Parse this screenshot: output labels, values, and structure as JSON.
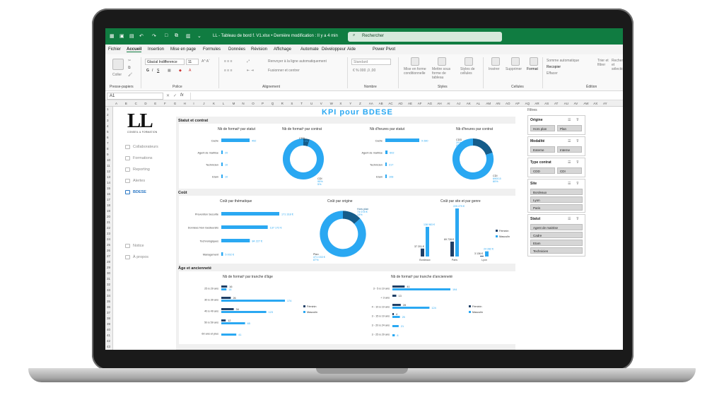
{
  "excel": {
    "file_title": "LL - Tableau de bord f. V1.xlsx • Dernière modification : Il y a 4 min",
    "search_placeholder": "Rechercher",
    "menu": [
      "Fichier",
      "Accueil",
      "Insertion",
      "Mise en page",
      "Formules",
      "Données",
      "Révision",
      "Affichage",
      "Automate",
      "Développeur",
      "Aide",
      "Power Pivot"
    ],
    "ribbon": {
      "paste": "Coller",
      "clipboard": "Presse-papiers",
      "font_name": "Glacial Indifference",
      "font_size": "11",
      "police": "Police",
      "wrap": "Renvoyer à la ligne automatiquement",
      "merge": "Fusionner et centrer",
      "alignment": "Alignement",
      "number_format": "Standard",
      "nombre": "Nombre",
      "cond_format": "Mise en forme conditionnelle",
      "table_format": "Mettre sous forme de tableau",
      "cell_styles": "Styles de cellules",
      "styles": "Styles",
      "insert": "Insérer",
      "delete": "Supprimer",
      "format": "Format",
      "cells": "Cellules",
      "autosum": "Somme automatique",
      "fill": "Recopier",
      "clear": "Effacer",
      "sort": "Trier et filtrer",
      "find": "Rechercher et sélectionner",
      "edition": "Édition"
    },
    "name_box": "A1",
    "formula_fx": "fx",
    "columns": [
      "A",
      "B",
      "C",
      "D",
      "E",
      "F",
      "G",
      "H",
      "I",
      "J",
      "K",
      "L",
      "M",
      "N",
      "O",
      "P",
      "Q",
      "R",
      "S",
      "T",
      "U",
      "V",
      "W",
      "X",
      "Y",
      "Z",
      "AA",
      "AB",
      "AC",
      "AD",
      "AE",
      "AF",
      "AG",
      "AH",
      "AI",
      "AJ",
      "AK",
      "AL",
      "AM",
      "AN",
      "AO",
      "AP",
      "AQ",
      "AR",
      "AS",
      "AT",
      "AU",
      "AV",
      "AW",
      "AX",
      "AY"
    ],
    "rows": [
      "1",
      "2",
      "3",
      "4",
      "5",
      "6",
      "7",
      "8",
      "9",
      "10",
      "11",
      "12",
      "13",
      "14",
      "15",
      "16",
      "17",
      "18",
      "19",
      "20",
      "21",
      "22",
      "23",
      "24",
      "25",
      "26",
      "27",
      "28",
      "29",
      "30",
      "31",
      "32",
      "33",
      "34",
      "35",
      "36",
      "37",
      "38",
      "39",
      "40",
      "41",
      "42",
      "43"
    ]
  },
  "logo": {
    "mark": "LL",
    "sub": "CONSEIL & FORMATION"
  },
  "nav": {
    "items": [
      "Collaborateurs",
      "Formations",
      "Reporting",
      "Alertes",
      "BDESE"
    ],
    "footer": [
      "Notice",
      "À propos"
    ]
  },
  "dashboard": {
    "title": "KPI pour BDESE",
    "sections": {
      "statut": "Statut et contrat",
      "cout": "Coût",
      "age": "Âge et ancienneté"
    }
  },
  "charts": {
    "formations_statut": {
      "title": "Nb de formatº par statut",
      "categories": [
        "Cadre",
        "Agent de maitrise",
        "Technicien",
        "Etam"
      ],
      "values": [
        "492",
        "20",
        "10",
        "10"
      ]
    },
    "formations_contrat": {
      "title": "Nb de formatº par contrat",
      "labels": [
        "CDD",
        "CDI"
      ],
      "pct": [
        "5%",
        "95%"
      ],
      "detail": "CDI 3%"
    },
    "heures_statut": {
      "title": "Nb d'heures par statut",
      "categories": [
        "Cadre",
        "Agent de maitrise",
        "Technicien",
        "Etam"
      ],
      "values": [
        "9 280",
        "602",
        "217",
        "108"
      ]
    },
    "heures_contrat": {
      "title": "Nb d'heures par contrat",
      "labels": [
        "CDD",
        "CDI"
      ],
      "pct": [
        "20%",
        "80%"
      ],
      "values": [
        "(5%)",
        "6900,5"
      ]
    },
    "cout_thematique": {
      "title": "Coût par thématique",
      "categories": [
        "Prevention Securite",
        "Données Non Gesteursils",
        "Technologiques",
        "Management"
      ],
      "values": [
        "171 318 €",
        "137 172 €",
        "84 227 €",
        "5 002 €"
      ]
    },
    "cout_origine": {
      "title": "Coût par origine",
      "labels": [
        "Hors plan",
        "Plan"
      ],
      "values": [
        "73 078 €",
        "471 033 €"
      ],
      "pct": [
        "13%",
        "87%"
      ]
    },
    "cout_site": {
      "title": "Coût par site et par genre",
      "categories": [
        "Bordeaux",
        "Paris",
        "Lyon"
      ],
      "feminin": [
        "37 201 €",
        "69 728 €",
        "3 136 €"
      ],
      "masculin": [
        "138 983 €",
        "225 279 €",
        "24 282 €"
      ],
      "legend": [
        "Féminin",
        "Masculin"
      ]
    },
    "age": {
      "title": "Nb de formatº par tranche d'âge",
      "categories": [
        "25 à 29 ans",
        "30 à 39 ans",
        "40 à 49 ans",
        "50 à 59 ans",
        "60 ans et plus"
      ],
      "feminin": [
        "16",
        "26",
        "34",
        "12",
        ""
      ],
      "masculin": [
        "14",
        "174",
        "123",
        "65",
        "41"
      ],
      "legend": [
        "Féminin",
        "Masculin"
      ]
    },
    "anciennete": {
      "title": "Nb de formatº par tranche d'ancienneté",
      "categories": [
        "3 - 5 à 19 ans",
        "< 3 ans",
        "4 - 10 à 19 ans",
        "3 - 15 à 19 ans",
        "3 - 20 à 24 ans",
        "3 - 25 à 29 ans"
      ],
      "feminin": [
        "41",
        "13",
        "28",
        "4",
        "",
        ""
      ],
      "masculin": [
        "194",
        "",
        "124",
        "25",
        "21",
        "8"
      ],
      "legend": [
        "Féminin",
        "Masculin"
      ]
    }
  },
  "filters": {
    "header": "Filtres",
    "groups": [
      {
        "title": "Origine",
        "chips": [
          "Hors plan",
          "Plan"
        ]
      },
      {
        "title": "Modalité",
        "chips": [
          "Externe",
          "Interne"
        ]
      },
      {
        "title": "Type contrat",
        "chips": [
          "CDD",
          "CDI"
        ]
      },
      {
        "title": "Site",
        "chips": [
          "Bordeaux",
          "Lyon",
          "Paris"
        ]
      },
      {
        "title": "Statut",
        "chips": [
          "Agent de maitrise",
          "Cadre",
          "Etam",
          "Technicien"
        ]
      }
    ]
  },
  "colors": {
    "accent": "#2aa8f2",
    "dark": "#1f3f66",
    "excel_green": "#107c41"
  }
}
